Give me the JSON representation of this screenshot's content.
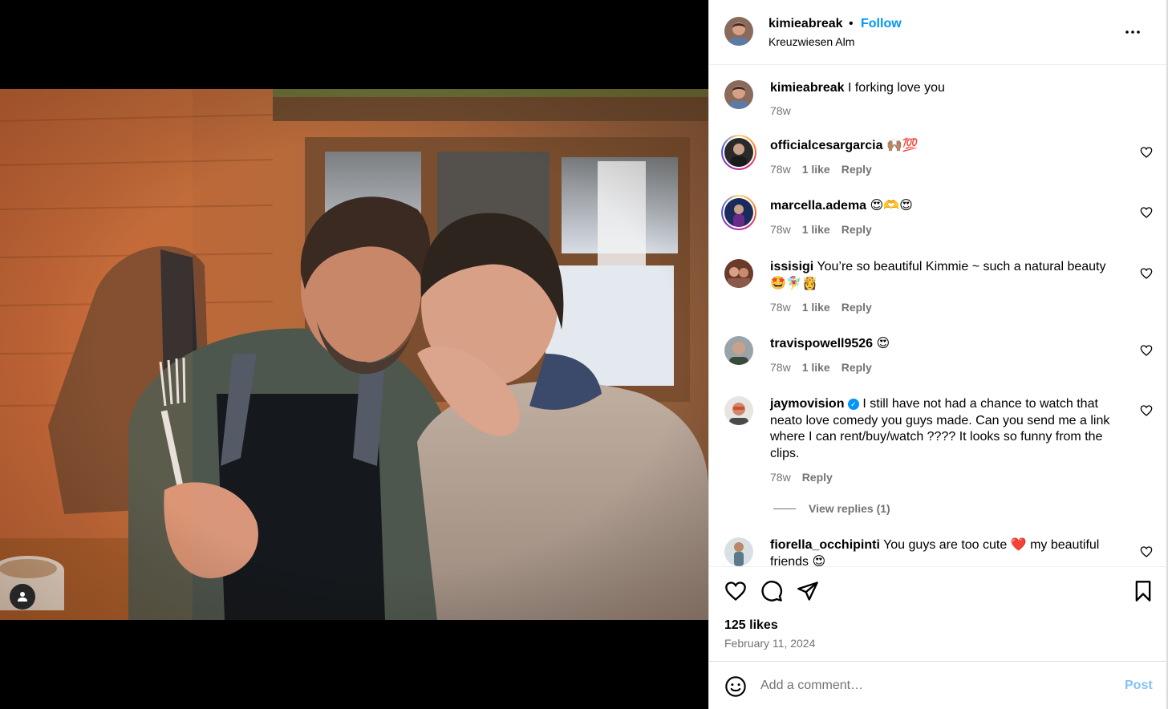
{
  "post": {
    "author": "kimieabreak",
    "follow_label": "Follow",
    "dot": "•",
    "location": "Kreuzwiesen Alm",
    "more_icon": "more-horizontal-icon",
    "caption": {
      "username": "kimieabreak",
      "text": "I forking love you",
      "time": "78w"
    },
    "likes": "125 likes",
    "date": "February 11, 2024"
  },
  "comments": [
    {
      "username": "officialcesargarcia",
      "text": "🙌🏽💯",
      "time": "78w",
      "likes": "1 like",
      "reply": "Reply"
    },
    {
      "username": "marcella.adema",
      "text": "😍🫶😍",
      "time": "78w",
      "likes": "1 like",
      "reply": "Reply"
    },
    {
      "username": "issisigi",
      "text": "You’re so beautiful Kimmie ~ such a natural beauty 🤩🧚‍♀️👸",
      "time": "78w",
      "likes": "1 like",
      "reply": "Reply"
    },
    {
      "username": "travispowell9526",
      "text": "😍",
      "time": "78w",
      "likes": "1 like",
      "reply": "Reply"
    },
    {
      "username": "jaymovision",
      "verified": "✓",
      "text": "I still have not had a chance to watch that neato love comedy you guys made. Can you send me a link where I can rent/buy/watch ???? It looks so funny from the clips.",
      "time": "78w",
      "reply": "Reply",
      "view_replies": "View replies (1)"
    },
    {
      "username": "fiorella_occhipinti",
      "text": "You guys are too cute ❤️ my beautiful friends 😍"
    }
  ],
  "actions": {
    "like_icon": "heart-icon",
    "comment_icon": "comment-bubble-icon",
    "share_icon": "send-paper-plane-icon",
    "save_icon": "bookmark-icon"
  },
  "composer": {
    "placeholder": "Add a comment…",
    "post_label": "Post"
  },
  "colors": {
    "accent": "#0095f6",
    "post_disabled": "#84c1f9",
    "muted": "#737373"
  }
}
